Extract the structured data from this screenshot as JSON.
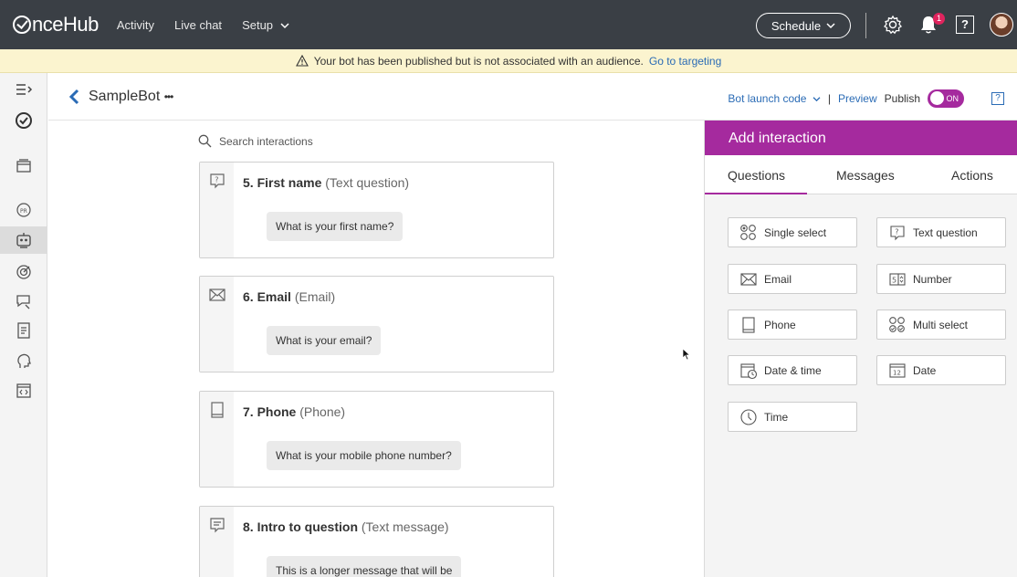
{
  "topnav": {
    "brand": "nceHub",
    "links": [
      "Activity",
      "Live chat",
      "Setup"
    ],
    "schedule_label": "Schedule",
    "notification_count": "1",
    "help_label": "?"
  },
  "banner": {
    "message": "Your bot has been published but is not associated with an audience.",
    "link": "Go to targeting"
  },
  "subheader": {
    "bot_name": "SampleBot",
    "more": "•••",
    "bot_launch_code": "Bot launch code",
    "separator": "|",
    "preview": "Preview",
    "publish": "Publish",
    "toggle_state": "ON",
    "help": "?"
  },
  "main": {
    "search_placeholder": "Search interactions",
    "cards": [
      {
        "number_name": "5. First name",
        "type": "(Text question)",
        "bubble": "What is your first name?",
        "icon": "text-question-icon"
      },
      {
        "number_name": "6. Email",
        "type": "(Email)",
        "bubble": "What is your email?",
        "icon": "envelope-icon"
      },
      {
        "number_name": "7. Phone",
        "type": "(Phone)",
        "bubble": "What is your mobile phone number?",
        "icon": "phone-icon"
      },
      {
        "number_name": "8. Intro to question",
        "type": "(Text message)",
        "bubble": "This is a longer message that will be",
        "icon": "message-icon"
      }
    ]
  },
  "panel": {
    "title": "Add interaction",
    "tabs": [
      "Questions",
      "Messages",
      "Actions"
    ],
    "active_tab": "Questions",
    "buttons": [
      {
        "label": "Single select",
        "icon": "single-select-icon"
      },
      {
        "label": "Text question",
        "icon": "text-question-icon"
      },
      {
        "label": "Email",
        "icon": "envelope-icon"
      },
      {
        "label": "Number",
        "icon": "number-icon"
      },
      {
        "label": "Phone",
        "icon": "phone-icon"
      },
      {
        "label": "Multi select",
        "icon": "multi-select-icon"
      },
      {
        "label": "Date & time",
        "icon": "date-time-icon"
      },
      {
        "label": "Date",
        "icon": "calendar-icon"
      },
      {
        "label": "Time",
        "icon": "clock-icon"
      }
    ]
  },
  "colors": {
    "topnav_bg": "#3a3f45",
    "accent_purple": "#a52a9e",
    "link_blue": "#2a6bb5",
    "banner_bg": "#fbf4cf"
  }
}
